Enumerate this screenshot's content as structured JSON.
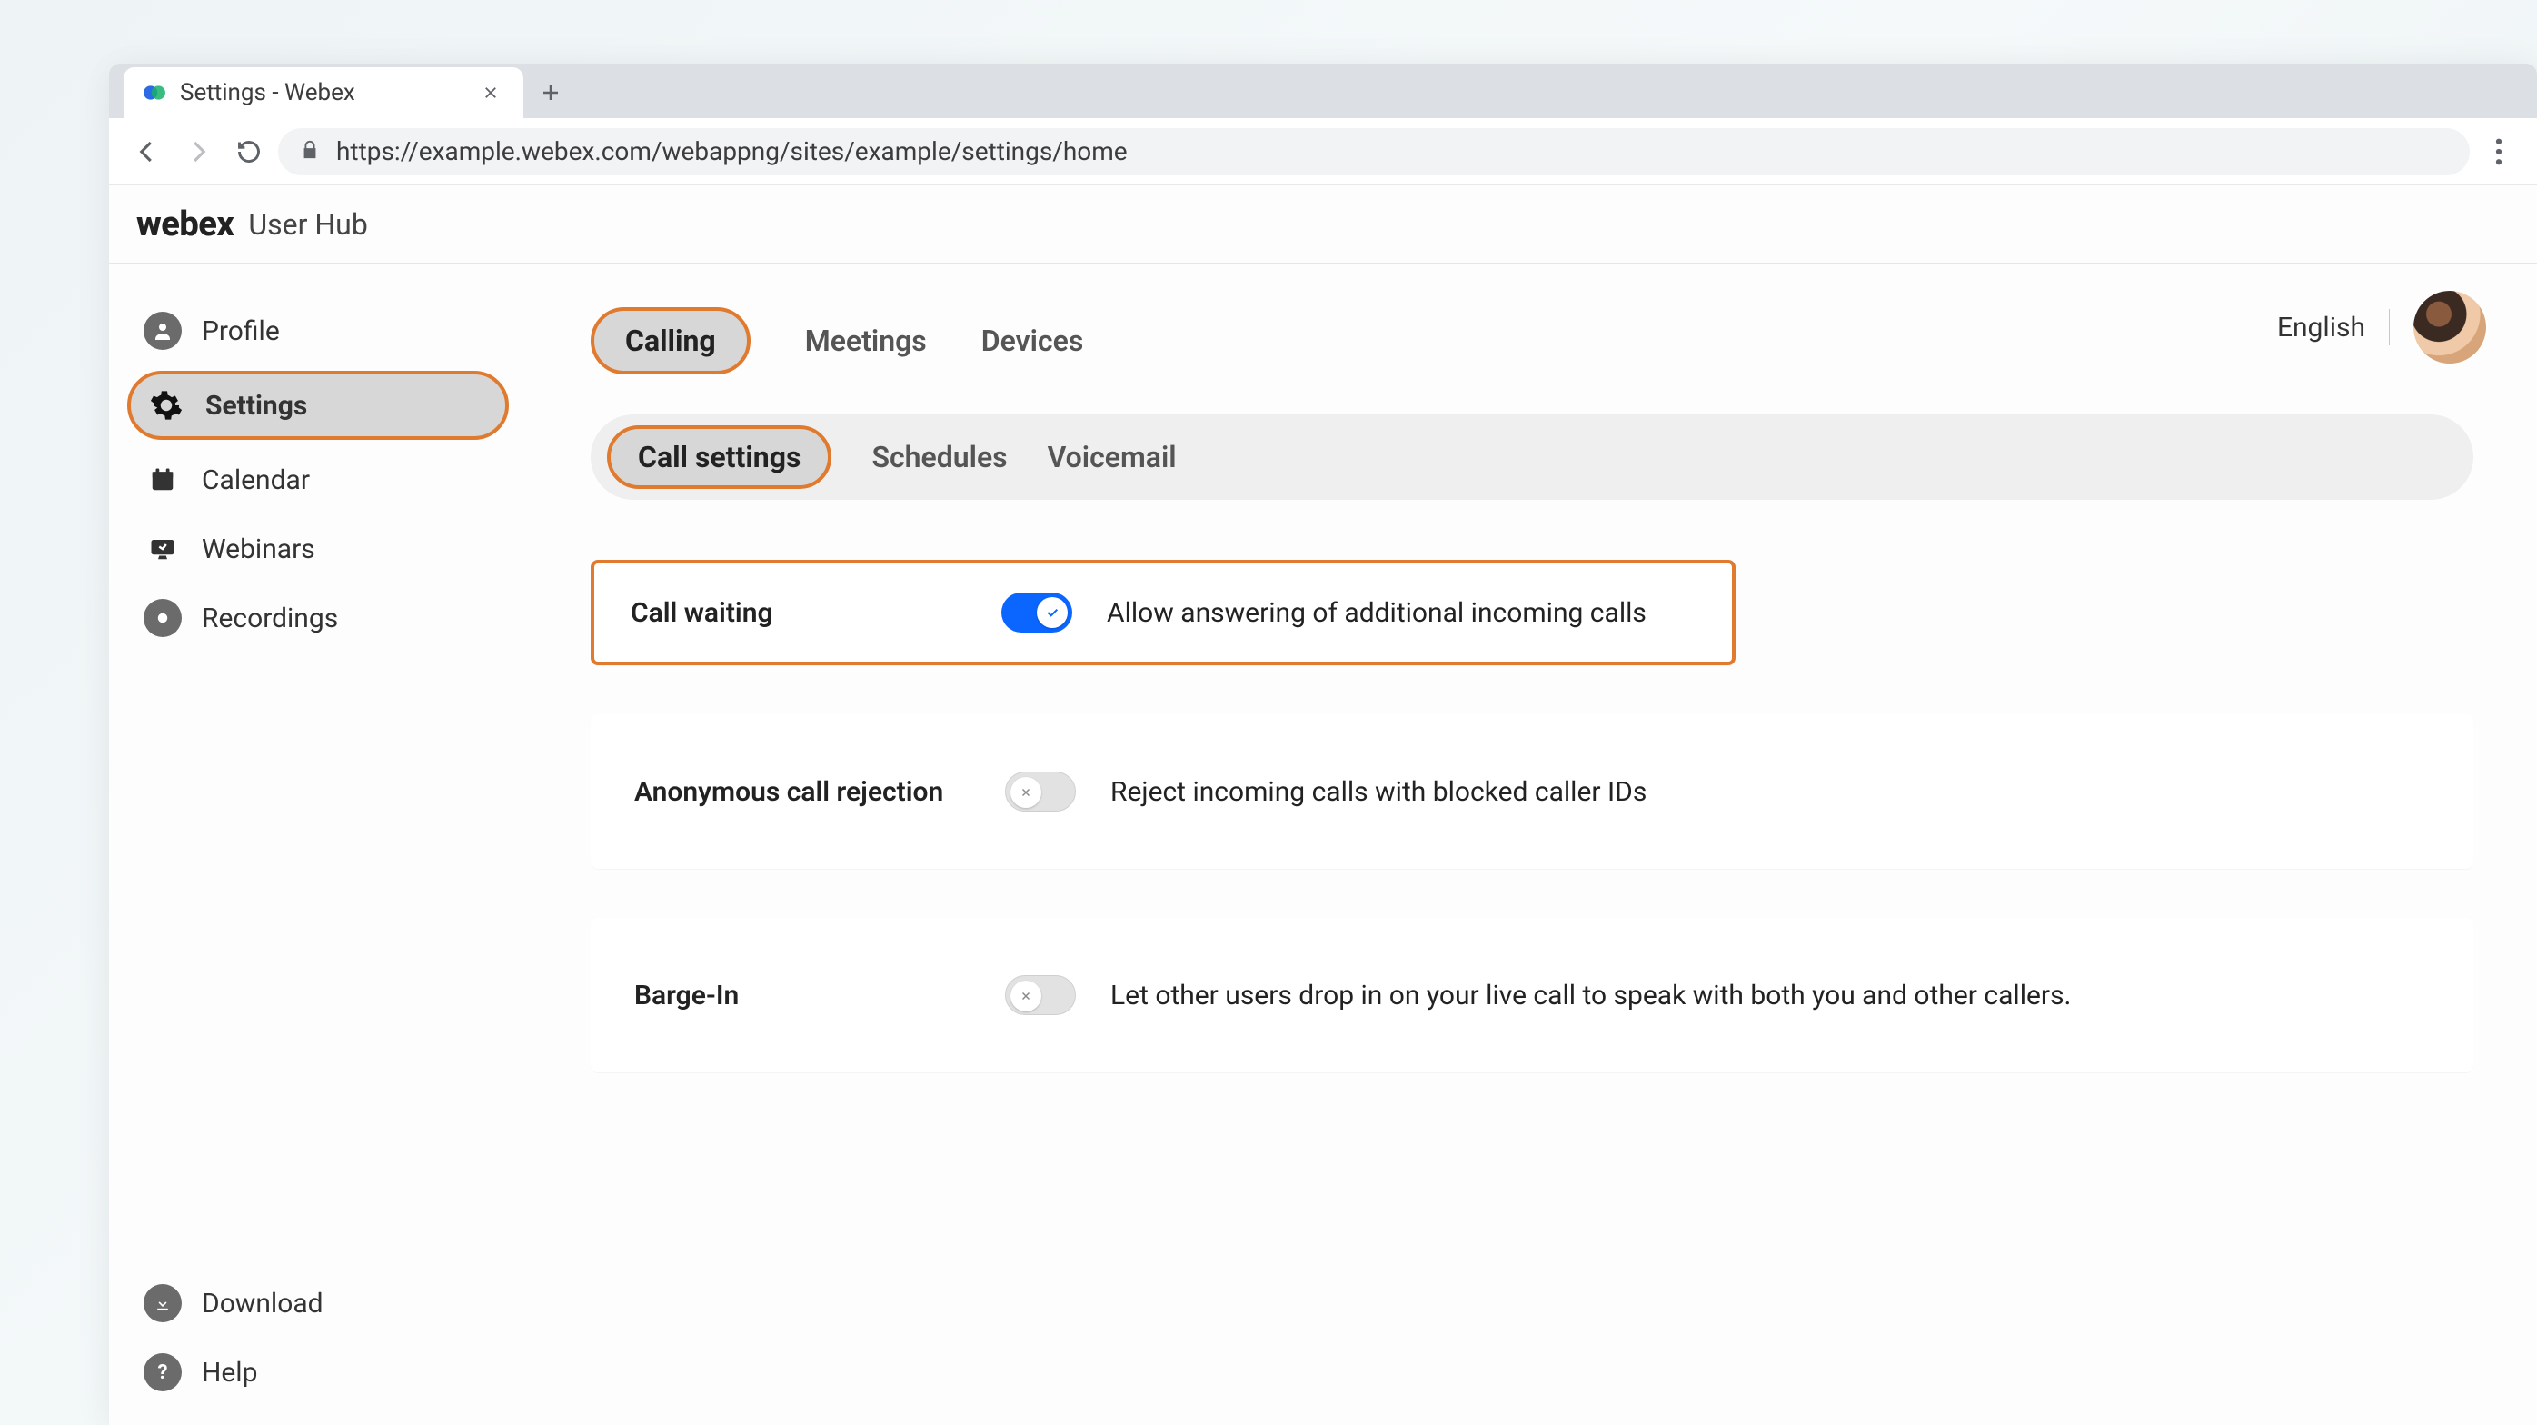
{
  "browser": {
    "tab_title": "Settings - Webex",
    "url": "https://example.webex.com/webappng/sites/example/settings/home"
  },
  "header": {
    "brand": "webex",
    "sub": "User Hub"
  },
  "topright": {
    "language": "English"
  },
  "sidebar": {
    "top": [
      {
        "id": "profile",
        "label": "Profile"
      },
      {
        "id": "settings",
        "label": "Settings",
        "active": true
      },
      {
        "id": "calendar",
        "label": "Calendar"
      },
      {
        "id": "webinars",
        "label": "Webinars"
      },
      {
        "id": "recordings",
        "label": "Recordings"
      }
    ],
    "bottom": [
      {
        "id": "download",
        "label": "Download"
      },
      {
        "id": "help",
        "label": "Help"
      }
    ]
  },
  "tabs": {
    "primary": [
      {
        "id": "calling",
        "label": "Calling",
        "active": true
      },
      {
        "id": "meetings",
        "label": "Meetings"
      },
      {
        "id": "devices",
        "label": "Devices"
      }
    ],
    "secondary": [
      {
        "id": "call-settings",
        "label": "Call settings",
        "active": true
      },
      {
        "id": "schedules",
        "label": "Schedules"
      },
      {
        "id": "voicemail",
        "label": "Voicemail"
      }
    ]
  },
  "settings": [
    {
      "id": "call-waiting",
      "label": "Call waiting",
      "description": "Allow answering of additional incoming calls",
      "enabled": true,
      "highlight": true
    },
    {
      "id": "anonymous-call-rejection",
      "label": "Anonymous call rejection",
      "description": "Reject incoming calls with blocked caller IDs",
      "enabled": false
    },
    {
      "id": "barge-in",
      "label": "Barge-In",
      "description": "Let other users drop in on your live call to speak with both you and other callers.",
      "enabled": false
    }
  ]
}
